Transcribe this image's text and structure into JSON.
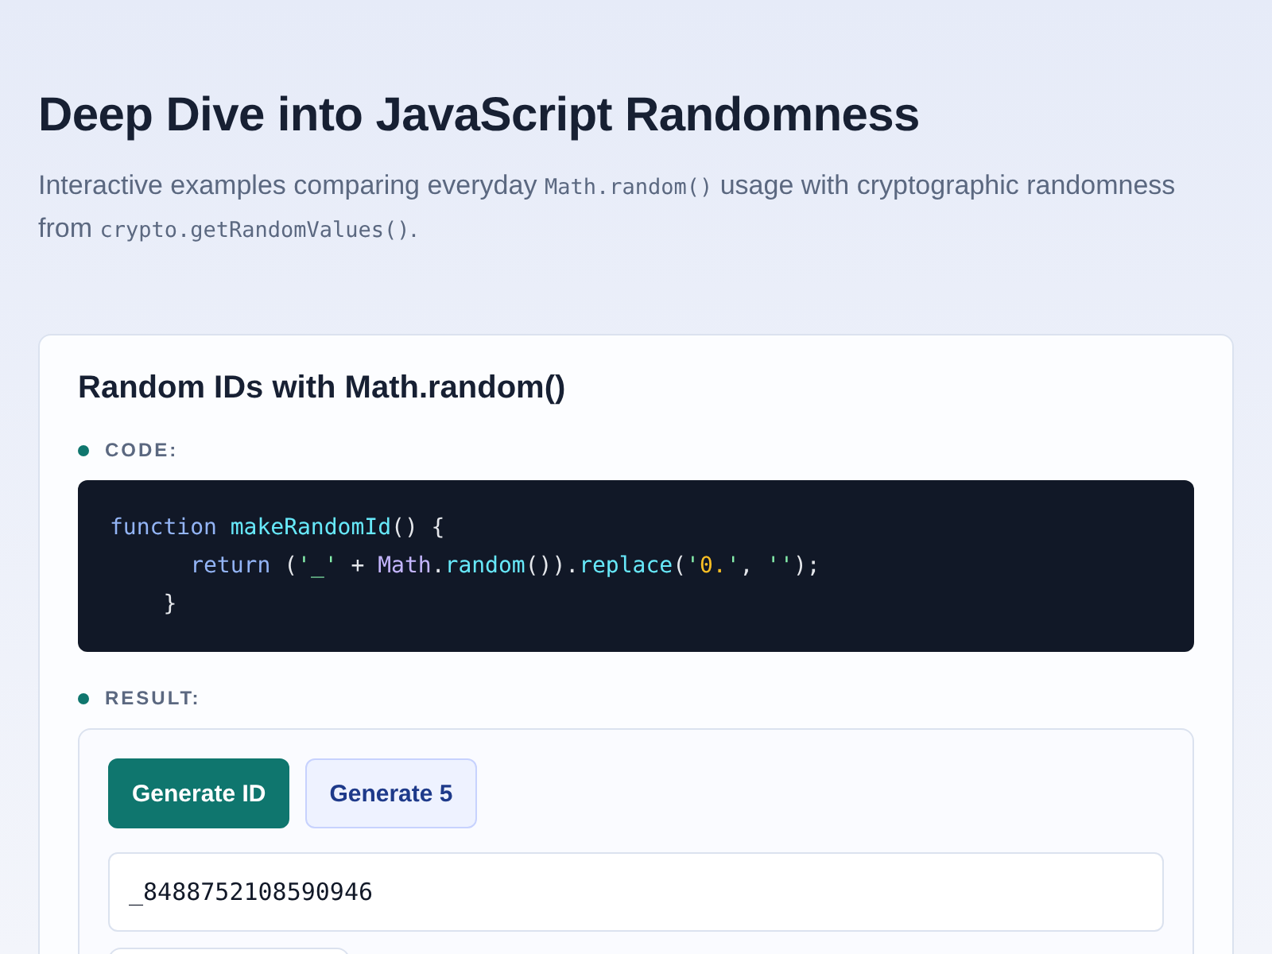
{
  "header": {
    "title": "Deep Dive into JavaScript Randomness",
    "subtitle": [
      {
        "kind": "text",
        "text": "Interactive examples comparing everyday "
      },
      {
        "kind": "code",
        "text": "Math.random()"
      },
      {
        "kind": "text",
        "text": " usage with cryptographic randomness from "
      },
      {
        "kind": "code",
        "text": "crypto.getRandomValues()"
      },
      {
        "kind": "text",
        "text": "."
      }
    ]
  },
  "card": {
    "title": "Random IDs with Math.random()",
    "code_label": "CODE:",
    "code_lines": [
      [
        {
          "kind": "keyword",
          "text": "function "
        },
        {
          "kind": "func",
          "text": "makeRandomId"
        },
        {
          "kind": "plain",
          "text": "() {"
        }
      ],
      [
        {
          "kind": "keyword",
          "text": "      return"
        },
        {
          "kind": "plain",
          "text": " ("
        },
        {
          "kind": "string",
          "text": "'_'"
        },
        {
          "kind": "plain",
          "text": " + "
        },
        {
          "kind": "object",
          "text": "Math"
        },
        {
          "kind": "plain",
          "text": "."
        },
        {
          "kind": "func",
          "text": "random"
        },
        {
          "kind": "plain",
          "text": "())."
        },
        {
          "kind": "func",
          "text": "replace"
        },
        {
          "kind": "plain",
          "text": "("
        },
        {
          "kind": "string",
          "text": "'"
        },
        {
          "kind": "number",
          "text": "0."
        },
        {
          "kind": "string",
          "text": "'"
        },
        {
          "kind": "plain",
          "text": ", "
        },
        {
          "kind": "string",
          "text": "''"
        },
        {
          "kind": "plain",
          "text": ");"
        }
      ],
      [
        {
          "kind": "plain",
          "text": "    }"
        }
      ]
    ],
    "result_label": "RESULT:",
    "buttons": [
      {
        "label": "Generate ID",
        "kind": "primary"
      },
      {
        "label": "Generate 5",
        "kind": "secondary"
      }
    ],
    "output": {
      "value": "_8488752108590946"
    }
  }
}
